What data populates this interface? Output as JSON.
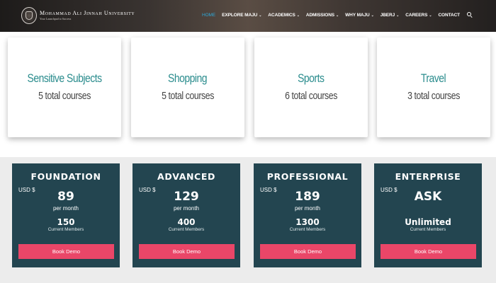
{
  "header": {
    "logo_name": "Mohammad Ali Jinnah University",
    "logo_tagline": "Your Launchpad to Success",
    "nav": [
      {
        "label": "HOME",
        "dropdown": false,
        "active": true
      },
      {
        "label": "EXPLORE MAJU",
        "dropdown": true,
        "active": false
      },
      {
        "label": "ACADEMICS",
        "dropdown": true,
        "active": false
      },
      {
        "label": "ADMISSIONS",
        "dropdown": true,
        "active": false
      },
      {
        "label": "WHY MAJU",
        "dropdown": true,
        "active": false
      },
      {
        "label": "JBERJ",
        "dropdown": true,
        "active": false
      },
      {
        "label": "CAREERS",
        "dropdown": true,
        "active": false
      },
      {
        "label": "CONTACT",
        "dropdown": false,
        "active": false
      }
    ],
    "colors": {
      "active": "#2fa7d6",
      "text": "#ffffff"
    }
  },
  "categories": [
    {
      "title": "Sensitive Subjects",
      "count": "5 total courses"
    },
    {
      "title": "Shopping",
      "count": "5 total courses"
    },
    {
      "title": "Sports",
      "count": "6 total courses"
    },
    {
      "title": "Travel",
      "count": "3 total courses"
    }
  ],
  "plans": [
    {
      "name": "FOUNDATION",
      "currency": "USD $",
      "price": "89",
      "period": "per month",
      "members": "150",
      "members_label": "Current Members",
      "cta": "Book Demo"
    },
    {
      "name": "ADVANCED",
      "currency": "USD $",
      "price": "129",
      "period": "per month",
      "members": "400",
      "members_label": "Current Members",
      "cta": "Book Demo"
    },
    {
      "name": "PROFESSIONAL",
      "currency": "USD $",
      "price": "189",
      "period": "per month",
      "members": "1300",
      "members_label": "Current Members",
      "cta": "Book Demo"
    },
    {
      "name": "ENTERPRISE",
      "currency": "USD $",
      "price": "ASK",
      "period": "",
      "members": "Unlimited",
      "members_label": "Current Members",
      "cta": "Book Demo"
    }
  ],
  "colors": {
    "plan_bg": "#234550",
    "cta_bg": "#ea4668",
    "category_title": "#2a8c8d"
  }
}
